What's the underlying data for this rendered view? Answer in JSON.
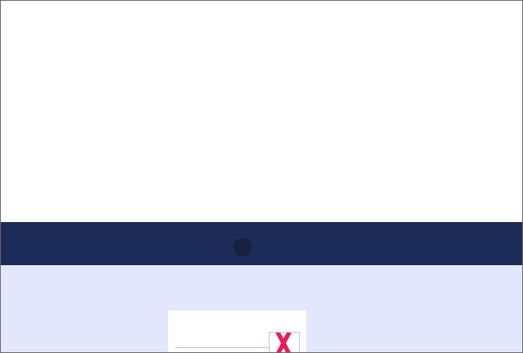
{
  "colors": {
    "page_background": "#ffffff",
    "nav_band": "#1c2b57",
    "nav_dot": "#18223f",
    "lower_background": "#e3e7fb",
    "card_background": "#ffffff",
    "underline": "#a9c1ea",
    "close_mark": "#e81c5b"
  },
  "icons": {
    "nav_dot": "circle-dot-icon",
    "close": "close-icon"
  }
}
